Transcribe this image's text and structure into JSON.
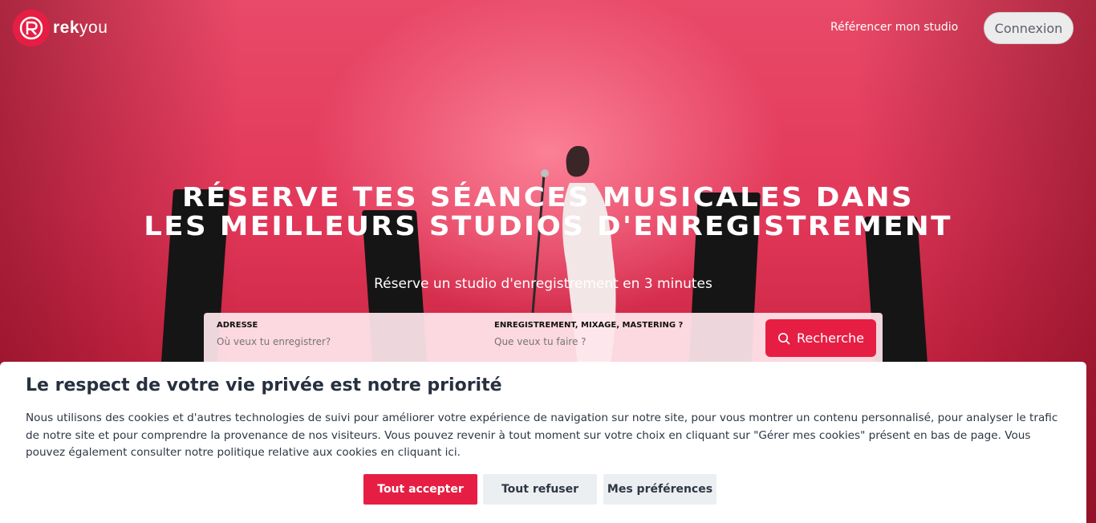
{
  "brand": {
    "name_bold": "rek",
    "name_light": "you"
  },
  "nav": {
    "list_studio_link": "Référencer mon studio",
    "login_button": "Connexion"
  },
  "hero": {
    "headline_line1": "RÉSERVE TES SÉANCES MUSICALES DANS",
    "headline_line2": "LES MEILLEURS STUDIOS D'ENREGISTREMENT",
    "subline": "Réserve un studio d'enregistrement en 3 minutes"
  },
  "search": {
    "address_label": "ADRESSE",
    "address_placeholder": "Où veux tu enregistrer?",
    "service_label": "ENREGISTREMENT, MIXAGE, MASTERING ?",
    "service_placeholder": "Que veux tu faire ?",
    "button_label": "Recherche"
  },
  "cookie": {
    "title": "Le respect de votre vie privée est notre priorité",
    "text": "Nous utilisons des cookies et d'autres technologies de suivi pour améliorer votre expérience de navigation sur notre site, pour vous montrer un contenu personnalisé, pour analyser le trafic de notre site et pour comprendre la provenance de nos visiteurs. Vous pouvez revenir à tout moment sur votre choix en cliquant sur \"Gérer mes cookies\" présent en bas de page. Vous pouvez également consulter notre politique relative aux cookies en cliquant ici.",
    "accept_label": "Tout accepter",
    "refuse_label": "Tout refuser",
    "prefs_label": "Mes préférences"
  },
  "colors": {
    "accent": "#e71e44",
    "hero": "#e2385a",
    "banner_text": "#27303f"
  },
  "icons": {
    "logo": "rekyou-logo-icon",
    "search": "search-icon"
  }
}
